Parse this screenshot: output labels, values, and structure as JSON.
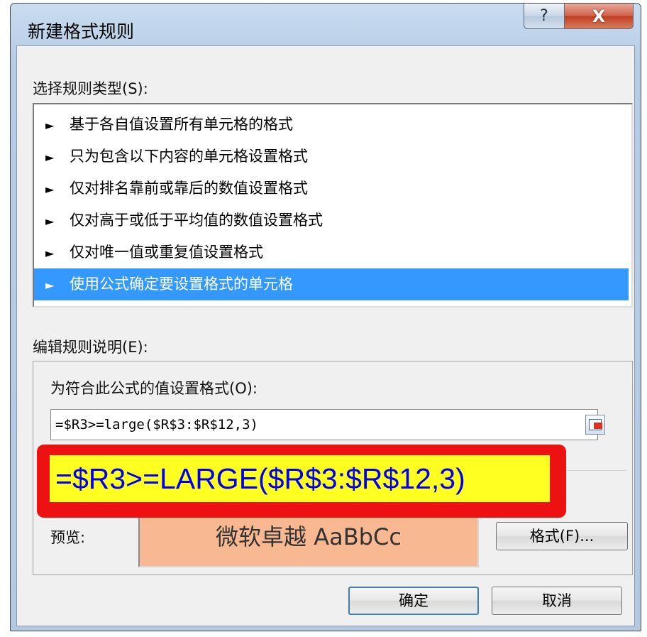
{
  "window": {
    "title": "新建格式规则",
    "help_label": "?",
    "close_label": "X"
  },
  "rule_type": {
    "label": "选择规则类型(S):",
    "arrow": "►",
    "items": [
      "基于各自值设置所有单元格的格式",
      "只为包含以下内容的单元格设置格式",
      "仅对排名靠前或靠后的数值设置格式",
      "仅对高于或低于平均值的数值设置格式",
      "仅对唯一值或重复值设置格式",
      "使用公式确定要设置格式的单元格"
    ],
    "selected_index": 5
  },
  "edit": {
    "label": "编辑规则说明(E):",
    "formula_label": "为符合此公式的值设置格式(O):",
    "formula_value": "=$R3>=large($R$3:$R$12,3)",
    "preview_label": "预览:",
    "preview_text": "微软卓越 AaBbCc",
    "preview_bg": "#f8b891",
    "format_button": "格式(F)..."
  },
  "buttons": {
    "ok": "确定",
    "cancel": "取消"
  },
  "callout": {
    "text": "=$R3>=LARGE($R$3:$R$12,3)",
    "border_color": "#ee1111",
    "fill_color": "#ffff22",
    "text_color": "#0000ee"
  },
  "colors": {
    "selection": "#3399ff",
    "title_bar": "#b7cde6"
  }
}
